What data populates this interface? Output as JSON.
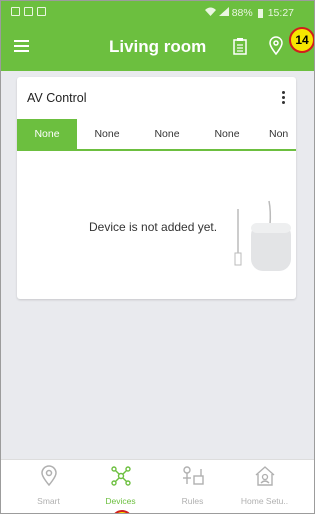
{
  "status_bar": {
    "signal": "📶",
    "battery_percent": "88%",
    "time": "15:27"
  },
  "app_bar": {
    "title": "Living room"
  },
  "step_badge": "14",
  "card": {
    "title": "AV Control",
    "tabs": [
      "None",
      "None",
      "None",
      "None",
      "Non"
    ],
    "active_tab_index": 0,
    "empty_message": "Device is not added yet."
  },
  "bottom_nav": {
    "items": [
      {
        "label": "Smart",
        "icon": "location-pin-icon"
      },
      {
        "label": "Devices",
        "icon": "network-nodes-icon"
      },
      {
        "label": "Rules",
        "icon": "rules-icon"
      },
      {
        "label": "Home Setu..",
        "icon": "home-icon"
      }
    ],
    "active_index": 1
  },
  "colors": {
    "accent": "#6cbf3f",
    "background": "#e9eaee",
    "badge_fill": "#f7e600",
    "badge_border": "#d11d1d"
  }
}
